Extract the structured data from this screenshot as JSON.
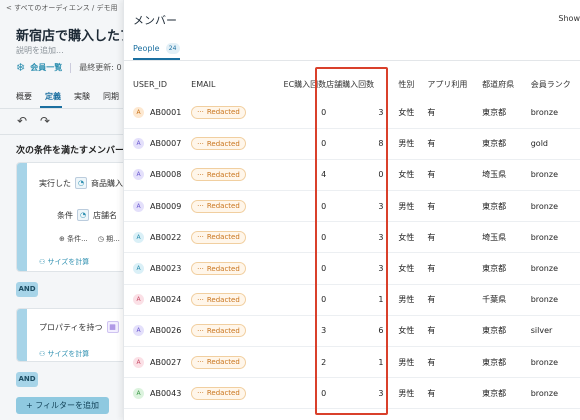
{
  "background": {
    "breadcrumb": "< すべてのオーディエンス / デモ用",
    "title": "新宿店で購入したアプ",
    "description": "説明を追加...",
    "member_list": "会員一覧",
    "last_updated": "最終更新: 0",
    "tabs": [
      "概要",
      "定義",
      "実験",
      "同期"
    ],
    "active_tab": "定義",
    "condition_title": "次の条件を満たすメンバー",
    "group1": {
      "executed": "実行した",
      "event": "商品購入",
      "condition_label": "条件",
      "condition_value": "店舗名",
      "ops": [
        "条件...",
        "期..."
      ],
      "calc_size": "サイズを計算"
    },
    "and_label": "AND",
    "group2": {
      "has_property": "プロパティを持つ",
      "calc_size": "サイズを計算"
    },
    "add_filter": "+ フィルターを追加"
  },
  "modal": {
    "title": "メンバー",
    "show": "Show",
    "tab_label": "People",
    "tab_count": "24",
    "columns": [
      "USER_ID",
      "EMAIL",
      "EC購入回数",
      "店舗購入回数",
      "性別",
      "アプリ利用",
      "都道府県",
      "会員ランク"
    ],
    "rows": [
      {
        "avatar": "A",
        "avatar_bg": "#fde8d0",
        "avatar_fg": "#c9741c",
        "user_id": "AB0001",
        "email": "Redacted",
        "ec": "0",
        "store": "3",
        "sex": "女性",
        "app": "有",
        "pref": "東京都",
        "rank": "bronze"
      },
      {
        "avatar": "A",
        "avatar_bg": "#e4e0fb",
        "avatar_fg": "#6d5bd0",
        "user_id": "AB0007",
        "email": "Redacted",
        "ec": "0",
        "store": "8",
        "sex": "男性",
        "app": "有",
        "pref": "東京都",
        "rank": "gold"
      },
      {
        "avatar": "A",
        "avatar_bg": "#e4e0fb",
        "avatar_fg": "#6d5bd0",
        "user_id": "AB0008",
        "email": "Redacted",
        "ec": "4",
        "store": "0",
        "sex": "女性",
        "app": "有",
        "pref": "埼玉県",
        "rank": "bronze"
      },
      {
        "avatar": "A",
        "avatar_bg": "#e4e0fb",
        "avatar_fg": "#6d5bd0",
        "user_id": "AB0009",
        "email": "Redacted",
        "ec": "0",
        "store": "3",
        "sex": "男性",
        "app": "有",
        "pref": "東京都",
        "rank": "bronze"
      },
      {
        "avatar": "A",
        "avatar_bg": "#daf0f7",
        "avatar_fg": "#2d8fb0",
        "user_id": "AB0022",
        "email": "Redacted",
        "ec": "0",
        "store": "3",
        "sex": "女性",
        "app": "有",
        "pref": "埼玉県",
        "rank": "bronze"
      },
      {
        "avatar": "A",
        "avatar_bg": "#daf0f7",
        "avatar_fg": "#2d8fb0",
        "user_id": "AB0023",
        "email": "Redacted",
        "ec": "0",
        "store": "3",
        "sex": "女性",
        "app": "有",
        "pref": "東京都",
        "rank": "bronze"
      },
      {
        "avatar": "A",
        "avatar_bg": "#fbe0e6",
        "avatar_fg": "#c9506a",
        "user_id": "AB0024",
        "email": "Redacted",
        "ec": "0",
        "store": "1",
        "sex": "男性",
        "app": "有",
        "pref": "千葉県",
        "rank": "bronze"
      },
      {
        "avatar": "A",
        "avatar_bg": "#e4e0fb",
        "avatar_fg": "#6d5bd0",
        "user_id": "AB0026",
        "email": "Redacted",
        "ec": "3",
        "store": "6",
        "sex": "女性",
        "app": "有",
        "pref": "東京都",
        "rank": "silver"
      },
      {
        "avatar": "A",
        "avatar_bg": "#fbe0e6",
        "avatar_fg": "#c9506a",
        "user_id": "AB0027",
        "email": "Redacted",
        "ec": "2",
        "store": "1",
        "sex": "男性",
        "app": "有",
        "pref": "東京都",
        "rank": "bronze"
      },
      {
        "avatar": "A",
        "avatar_bg": "#dcf3de",
        "avatar_fg": "#3f9a4a",
        "user_id": "AB0043",
        "email": "Redacted",
        "ec": "0",
        "store": "3",
        "sex": "男性",
        "app": "有",
        "pref": "東京都",
        "rank": "bronze"
      }
    ]
  },
  "colors": {
    "accent": "#1b6fa0",
    "highlight": "#d9402b",
    "redacted": "#c9741c"
  }
}
